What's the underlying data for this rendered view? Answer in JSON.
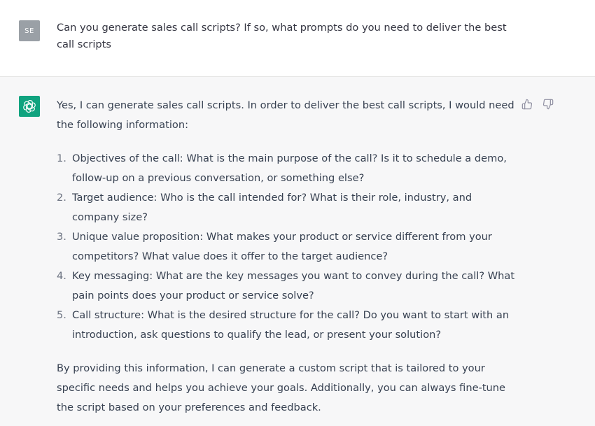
{
  "user_message": {
    "avatar_initials": "SE",
    "text": "Can you generate sales call scripts? If so, what prompts do you need to deliver the best call scripts"
  },
  "assistant_message": {
    "avatar_icon": "openai-logo-icon",
    "intro": "Yes, I can generate sales call scripts. In order to deliver the best call scripts, I would need the following information:",
    "items": [
      {
        "num": "1.",
        "text": "Objectives of the call: What is the main purpose of the call? Is it to schedule a demo, follow-up on a previous conversation, or something else?"
      },
      {
        "num": "2.",
        "text": "Target audience: Who is the call intended for? What is their role, industry, and company size?"
      },
      {
        "num": "3.",
        "text": "Unique value proposition: What makes your product or service different from your competitors? What value does it offer to the target audience?"
      },
      {
        "num": "4.",
        "text": "Key messaging: What are the key messages you want to convey during the call? What pain points does your product or service solve?"
      },
      {
        "num": "5.",
        "text": "Call structure: What is the desired structure for the call? Do you want to start with an introduction, ask questions to qualify the lead, or present your solution?"
      }
    ],
    "conclusion": "By providing this information, I can generate a custom script that is tailored to your specific needs and helps you achieve your goals. Additionally, you can always fine-tune the script based on your preferences and feedback."
  },
  "feedback": {
    "like_icon": "thumbs-up-icon",
    "dislike_icon": "thumbs-down-icon"
  },
  "colors": {
    "assistant_bg": "#f7f7f8",
    "brand_green": "#10a37f",
    "user_avatar": "#9aa0a6"
  }
}
